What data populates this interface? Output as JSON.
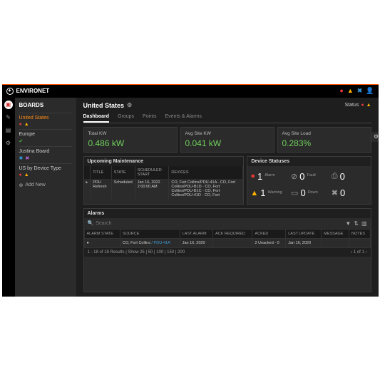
{
  "app": {
    "name": "ENVIRONET"
  },
  "topbar_icons": [
    "info-icon",
    "warning-icon",
    "tools-icon",
    "user-icon"
  ],
  "sidebar": {
    "title": "BOARDS",
    "items": [
      {
        "name": "United States",
        "selected": true,
        "icons": [
          "info-red",
          "warn-yel"
        ]
      },
      {
        "name": "Europe",
        "selected": false,
        "icons": [
          "ok-grn"
        ]
      },
      {
        "name": "Justina Board",
        "selected": false,
        "icons": [
          "tools-blu",
          "tools-pur"
        ]
      },
      {
        "name": "US by Device Type",
        "selected": false,
        "icons": [
          "info-red",
          "warn-yel"
        ]
      }
    ],
    "add_label": "Add New"
  },
  "header": {
    "title": "United States",
    "status_label": "Status"
  },
  "tabs": [
    "Dashboard",
    "Groups",
    "Points",
    "Events & Alarms"
  ],
  "kpis": [
    {
      "label": "Total KW",
      "value": "0.486 kW"
    },
    {
      "label": "Avg Site KW",
      "value": "0.041 kW"
    },
    {
      "label": "Avg Site Load",
      "value": "0.283%"
    }
  ],
  "maintenance": {
    "title": "Upcoming Maintenance",
    "cols": [
      "",
      "TITLE",
      "STATE",
      "SCHEDULED START",
      "DEVICES"
    ],
    "row": {
      "title": "PDU Refresh",
      "state": "Scheduled",
      "start": "Jan 16, 2022 2:00:00 AM",
      "devs": "CO, Fort Collins/PDU-41A · CO, Fort Collins/PDU-B1D · CO, Fort Collins/PDU-B1C · CO, Fort Collins/PDU-41D · CO, Fort"
    }
  },
  "devstat": {
    "title": "Device Statuses",
    "items": [
      {
        "icon": "●",
        "cls": "red",
        "num": "1",
        "lbl": "Alarm"
      },
      {
        "icon": "⊘",
        "cls": "gry",
        "num": "0",
        "lbl": "Fault"
      },
      {
        "icon": "▲",
        "cls": "yel",
        "num": "1",
        "lbl": "Warning"
      },
      {
        "icon": "⎋",
        "cls": "gry",
        "num": "0",
        "lbl": "Down"
      },
      {
        "icon": "●",
        "cls": "gry",
        "num": "0",
        "lbl": ""
      },
      {
        "icon": "✖",
        "cls": "gry",
        "num": "0",
        "lbl": ""
      }
    ]
  },
  "alarms": {
    "title": "Alarms",
    "search_placeholder": "Search",
    "cols": [
      "ALARM STATE",
      "SOURCE",
      "LAST ALARM",
      "ACK REQUIRED",
      "ACKED",
      "LAST UPDATE",
      "MESSAGE",
      "NOTES"
    ],
    "row": {
      "state": "●",
      "source": "CO, Fort Collins / PDU-41A",
      "last": "Jan 16, 2020",
      "ack": "",
      "acked": "2 Unacked - 0",
      "update": "Jan 16, 2020",
      "msg": "",
      "notes": ""
    },
    "pager_left": "1 - 18 of 18 Results | Show 25 | 50 | 100 | 150 | 200",
    "pager_right": "1   of 1"
  }
}
